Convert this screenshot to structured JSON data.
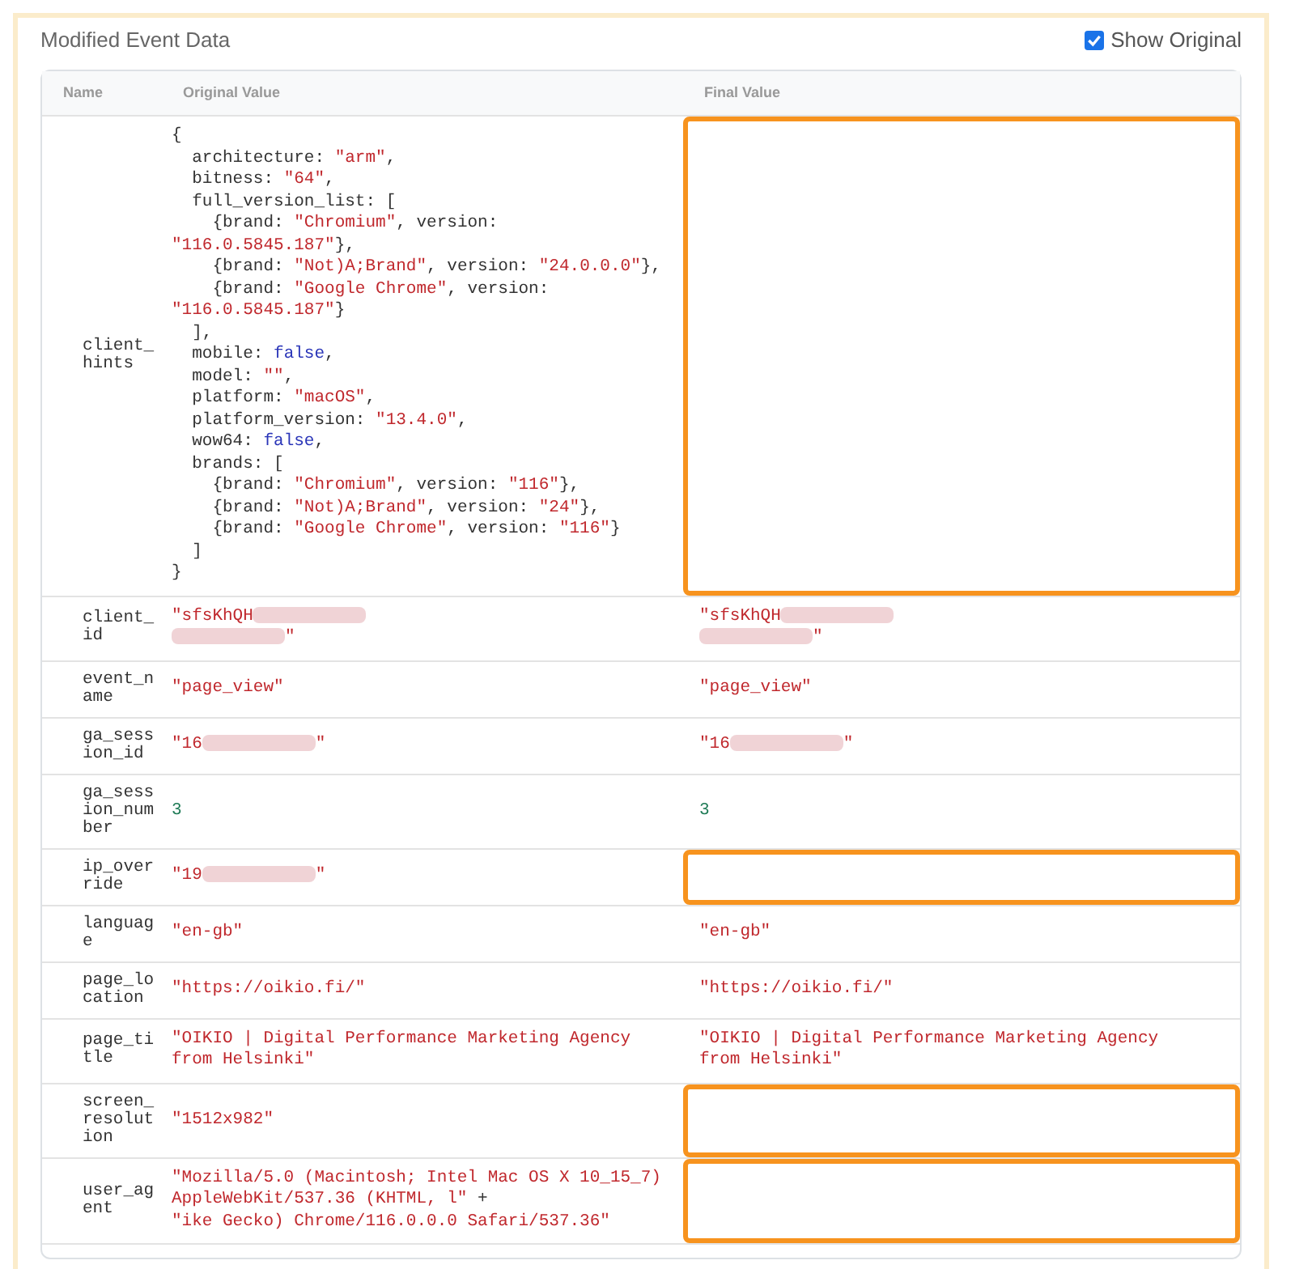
{
  "title": "Modified Event Data",
  "show_original": {
    "label": "Show Original",
    "checked": true
  },
  "columns": [
    "Name",
    "Original Value",
    "Final Value"
  ],
  "rows": [
    {
      "name": "client_hints",
      "original": [
        [
          {
            "kind": "plain",
            "t": "{"
          }
        ],
        [
          {
            "kind": "plain",
            "t": "  architecture: "
          },
          {
            "kind": "string",
            "t": "\"arm\""
          },
          {
            "kind": "plain",
            "t": ","
          }
        ],
        [
          {
            "kind": "plain",
            "t": "  bitness: "
          },
          {
            "kind": "string",
            "t": "\"64\""
          },
          {
            "kind": "plain",
            "t": ","
          }
        ],
        [
          {
            "kind": "plain",
            "t": "  full_version_list: ["
          }
        ],
        [
          {
            "kind": "plain",
            "t": "    {brand: "
          },
          {
            "kind": "string",
            "t": "\"Chromium\""
          },
          {
            "kind": "plain",
            "t": ", version:"
          }
        ],
        [
          {
            "kind": "string",
            "t": "\"116.0.5845.187\""
          },
          {
            "kind": "plain",
            "t": "},"
          }
        ],
        [
          {
            "kind": "plain",
            "t": "    {brand: "
          },
          {
            "kind": "string",
            "t": "\"Not)A;Brand\""
          },
          {
            "kind": "plain",
            "t": ", version: "
          },
          {
            "kind": "string",
            "t": "\"24.0.0.0\""
          },
          {
            "kind": "plain",
            "t": "},"
          }
        ],
        [
          {
            "kind": "plain",
            "t": "    {brand: "
          },
          {
            "kind": "string",
            "t": "\"Google Chrome\""
          },
          {
            "kind": "plain",
            "t": ", version:"
          }
        ],
        [
          {
            "kind": "string",
            "t": "\"116.0.5845.187\""
          },
          {
            "kind": "plain",
            "t": "}"
          }
        ],
        [
          {
            "kind": "plain",
            "t": "  ],"
          }
        ],
        [
          {
            "kind": "plain",
            "t": "  mobile: "
          },
          {
            "kind": "keyword",
            "t": "false"
          },
          {
            "kind": "plain",
            "t": ","
          }
        ],
        [
          {
            "kind": "plain",
            "t": "  model: "
          },
          {
            "kind": "string",
            "t": "\"\""
          },
          {
            "kind": "plain",
            "t": ","
          }
        ],
        [
          {
            "kind": "plain",
            "t": "  platform: "
          },
          {
            "kind": "string",
            "t": "\"macOS\""
          },
          {
            "kind": "plain",
            "t": ","
          }
        ],
        [
          {
            "kind": "plain",
            "t": "  platform_version: "
          },
          {
            "kind": "string",
            "t": "\"13.4.0\""
          },
          {
            "kind": "plain",
            "t": ","
          }
        ],
        [
          {
            "kind": "plain",
            "t": "  wow64: "
          },
          {
            "kind": "keyword",
            "t": "false"
          },
          {
            "kind": "plain",
            "t": ","
          }
        ],
        [
          {
            "kind": "plain",
            "t": "  brands: ["
          }
        ],
        [
          {
            "kind": "plain",
            "t": "    {brand: "
          },
          {
            "kind": "string",
            "t": "\"Chromium\""
          },
          {
            "kind": "plain",
            "t": ", version: "
          },
          {
            "kind": "string",
            "t": "\"116\""
          },
          {
            "kind": "plain",
            "t": "},"
          }
        ],
        [
          {
            "kind": "plain",
            "t": "    {brand: "
          },
          {
            "kind": "string",
            "t": "\"Not)A;Brand\""
          },
          {
            "kind": "plain",
            "t": ", version: "
          },
          {
            "kind": "string",
            "t": "\"24\""
          },
          {
            "kind": "plain",
            "t": "},"
          }
        ],
        [
          {
            "kind": "plain",
            "t": "    {brand: "
          },
          {
            "kind": "string",
            "t": "\"Google Chrome\""
          },
          {
            "kind": "plain",
            "t": ", version: "
          },
          {
            "kind": "string",
            "t": "\"116\""
          },
          {
            "kind": "plain",
            "t": "}"
          }
        ],
        [
          {
            "kind": "plain",
            "t": "  ]"
          }
        ],
        [
          {
            "kind": "plain",
            "t": "}"
          }
        ]
      ],
      "final": [],
      "highlighted": true
    },
    {
      "name": "client_id",
      "original": [
        [
          {
            "kind": "string",
            "t": "\"sfsKhQH"
          },
          {
            "kind": "redacted"
          }
        ],
        [
          {
            "kind": "redacted"
          },
          {
            "kind": "string",
            "t": "\""
          }
        ]
      ],
      "final": [
        [
          {
            "kind": "string",
            "t": "\"sfsKhQH"
          },
          {
            "kind": "redacted"
          }
        ],
        [
          {
            "kind": "redacted"
          },
          {
            "kind": "string",
            "t": "\""
          }
        ]
      ],
      "highlighted": false
    },
    {
      "name": "event_name",
      "original": [
        [
          {
            "kind": "string",
            "t": "\"page_view\""
          }
        ]
      ],
      "final": [
        [
          {
            "kind": "string",
            "t": "\"page_view\""
          }
        ]
      ],
      "highlighted": false
    },
    {
      "name": "ga_session_id",
      "original": [
        [
          {
            "kind": "string",
            "t": "\"16"
          },
          {
            "kind": "redacted"
          },
          {
            "kind": "string",
            "t": "\""
          }
        ]
      ],
      "final": [
        [
          {
            "kind": "string",
            "t": "\"16"
          },
          {
            "kind": "redacted"
          },
          {
            "kind": "string",
            "t": "\""
          }
        ]
      ],
      "highlighted": false
    },
    {
      "name": "ga_session_number",
      "original": [
        [
          {
            "kind": "number",
            "t": "3"
          }
        ]
      ],
      "final": [
        [
          {
            "kind": "number",
            "t": "3"
          }
        ]
      ],
      "highlighted": false
    },
    {
      "name": "ip_override",
      "original": [
        [
          {
            "kind": "string",
            "t": "\"19"
          },
          {
            "kind": "redacted"
          },
          {
            "kind": "string",
            "t": "\""
          }
        ]
      ],
      "final": [],
      "highlighted": true
    },
    {
      "name": "language",
      "original": [
        [
          {
            "kind": "string",
            "t": "\"en-gb\""
          }
        ]
      ],
      "final": [
        [
          {
            "kind": "string",
            "t": "\"en-gb\""
          }
        ]
      ],
      "highlighted": false
    },
    {
      "name": "page_location",
      "original": [
        [
          {
            "kind": "string",
            "t": "\"https://oikio.fi/\""
          }
        ]
      ],
      "final": [
        [
          {
            "kind": "string",
            "t": "\"https://oikio.fi/\""
          }
        ]
      ],
      "highlighted": false
    },
    {
      "name": "page_title",
      "original": [
        [
          {
            "kind": "string",
            "t": "\"OIKIO | Digital Performance Marketing Agency"
          }
        ],
        [
          {
            "kind": "string",
            "t": "from Helsinki\""
          }
        ]
      ],
      "final": [
        [
          {
            "kind": "string",
            "t": "\"OIKIO | Digital Performance Marketing Agency"
          }
        ],
        [
          {
            "kind": "string",
            "t": "from Helsinki\""
          }
        ]
      ],
      "highlighted": false
    },
    {
      "name": "screen_resolution",
      "original": [
        [
          {
            "kind": "string",
            "t": "\"1512x982\""
          }
        ]
      ],
      "final": [],
      "highlighted": true
    },
    {
      "name": "user_agent",
      "original": [
        [
          {
            "kind": "string",
            "t": "\"Mozilla/5.0 (Macintosh; Intel Mac OS X 10_15_7)"
          }
        ],
        [
          {
            "kind": "string",
            "t": "AppleWebKit/537.36 (KHTML, l\""
          },
          {
            "kind": "plain",
            "t": " +"
          }
        ],
        [
          {
            "kind": "string",
            "t": "\"ike Gecko) Chrome/116.0.0.0 Safari/537.36\""
          }
        ]
      ],
      "final": [],
      "highlighted": true
    }
  ]
}
